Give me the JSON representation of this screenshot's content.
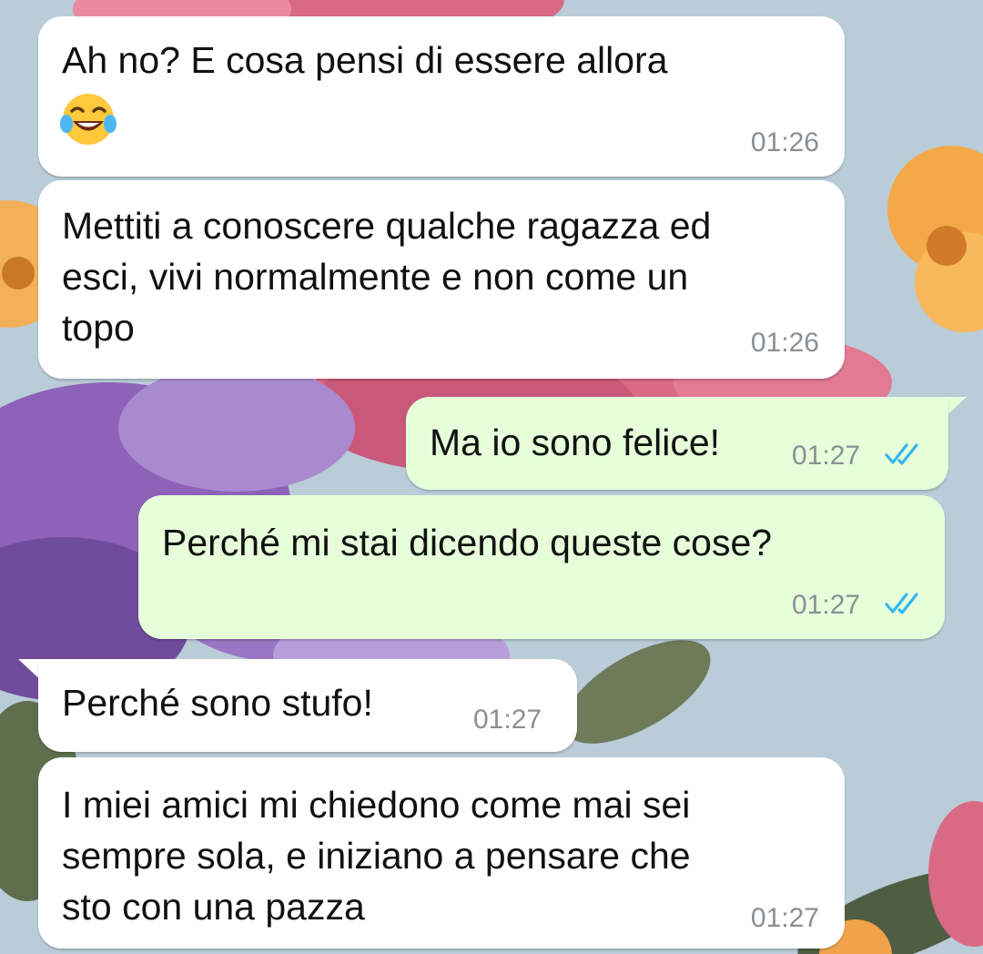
{
  "conversation": {
    "messages": [
      {
        "direction": "incoming",
        "text": "Ah no? E cosa pensi di essere allora",
        "emoji": "face-with-tears-of-joy-icon",
        "time": "01:26"
      },
      {
        "direction": "incoming",
        "text": "Mettiti a conoscere qualche ragazza ed\nesci, vivi normalmente e non come un\ntopo",
        "time": "01:26"
      },
      {
        "direction": "outgoing",
        "text": "Ma io sono felice!",
        "time": "01:27",
        "status": "read",
        "status_icon": "double-check-read-icon"
      },
      {
        "direction": "outgoing",
        "text": "Perché mi stai dicendo queste cose?",
        "time": "01:27",
        "status": "read",
        "status_icon": "double-check-read-icon"
      },
      {
        "direction": "incoming",
        "text": "Perché sono stufo!",
        "time": "01:27"
      },
      {
        "direction": "incoming",
        "text": "I miei amici mi chiedono come mai sei\nsempre sola, e iniziano a pensare che\nsto con una pazza",
        "time": "01:27"
      }
    ]
  },
  "colors": {
    "incoming_bubble": "#ffffff",
    "outgoing_bubble": "#e6ffda",
    "time_text": "#8a8f93",
    "read_ticks": "#34b7f1",
    "wallpaper_base": "#b9ccd8"
  }
}
